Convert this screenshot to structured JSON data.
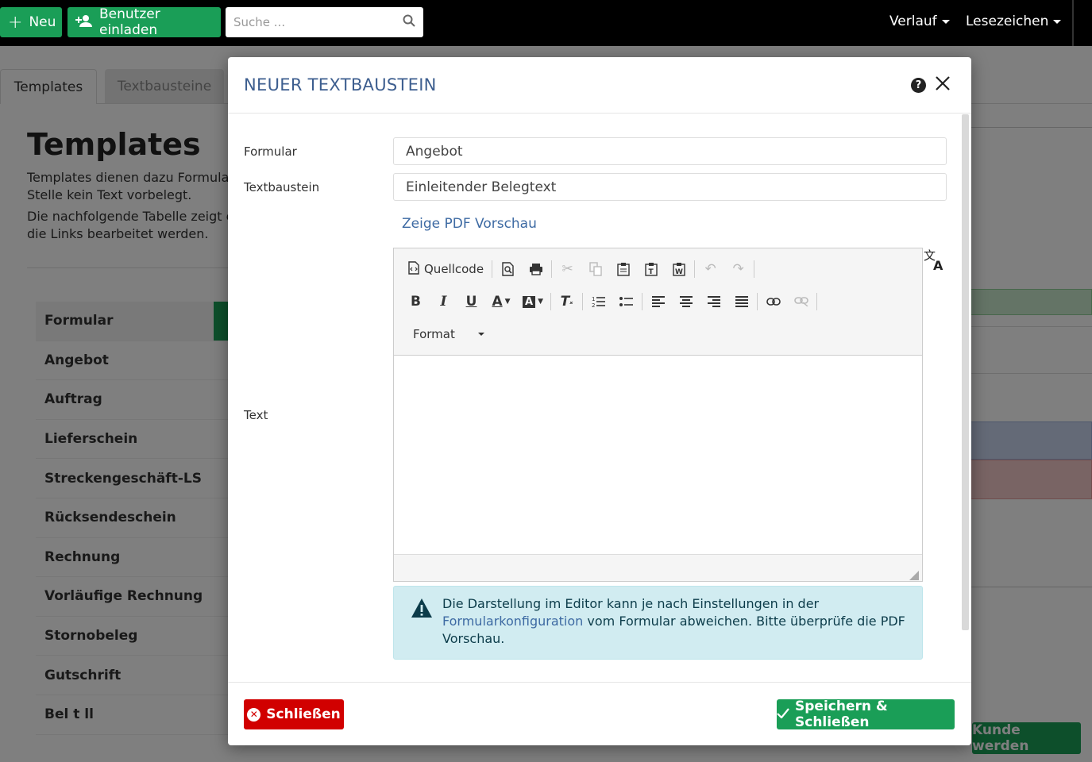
{
  "topbar": {
    "new_label": "Neu",
    "invite_label": "Benutzer einladen",
    "search_placeholder": "Suche ...",
    "history_label": "Verlauf",
    "bookmarks_label": "Lesezeichen"
  },
  "page": {
    "tabs": [
      {
        "label": "Templates"
      },
      {
        "label": "Textbausteine"
      }
    ],
    "title": "Templates",
    "desc_lines": [
      "Templates dienen dazu Formular",
      "Stelle kein Text vorbelegt.",
      "Die nachfolgende Tabelle zeigt e",
      "die Links bearbeitet werden."
    ],
    "forms": [
      {
        "label": "Formular"
      },
      {
        "label": "Angebot"
      },
      {
        "label": "Auftrag"
      },
      {
        "label": "Lieferschein"
      },
      {
        "label": "Streckengeschäft-LS"
      },
      {
        "label": "Rücksendeschein"
      },
      {
        "label": "Rechnung"
      },
      {
        "label": "Vorläufige Rechnung"
      },
      {
        "label": "Stornobeleg"
      },
      {
        "label": "Gutschrift"
      },
      {
        "label": "Bel       t ll"
      }
    ],
    "cta_label": "Kunde werden"
  },
  "modal": {
    "title": "NEUER TEXTBAUSTEIN",
    "formular_label": "Formular",
    "formular_value": "Angebot",
    "textbaustein_label": "Textbaustein",
    "textbaustein_value": "Einleitender Belegtext",
    "pdf_link": "Zeige PDF Vorschau",
    "text_label": "Text",
    "editor": {
      "source_label": "Quellcode",
      "format_label": "Format",
      "content": ""
    },
    "alert": {
      "text_before": "Die Darstellung im Editor kann je nach Einstellungen in der ",
      "link": "Formularkonfiguration",
      "text_after": " vom Formular abweichen. Bitte überprüfe die PDF Vorschau."
    },
    "close_label": "Schließen",
    "save_label": "Speichern & Schließen"
  },
  "colors": {
    "accent_green": "#1a9e57",
    "danger_red": "#d10000",
    "title_blue": "#3d5e8f",
    "alert_bg": "#d1ecf1"
  }
}
